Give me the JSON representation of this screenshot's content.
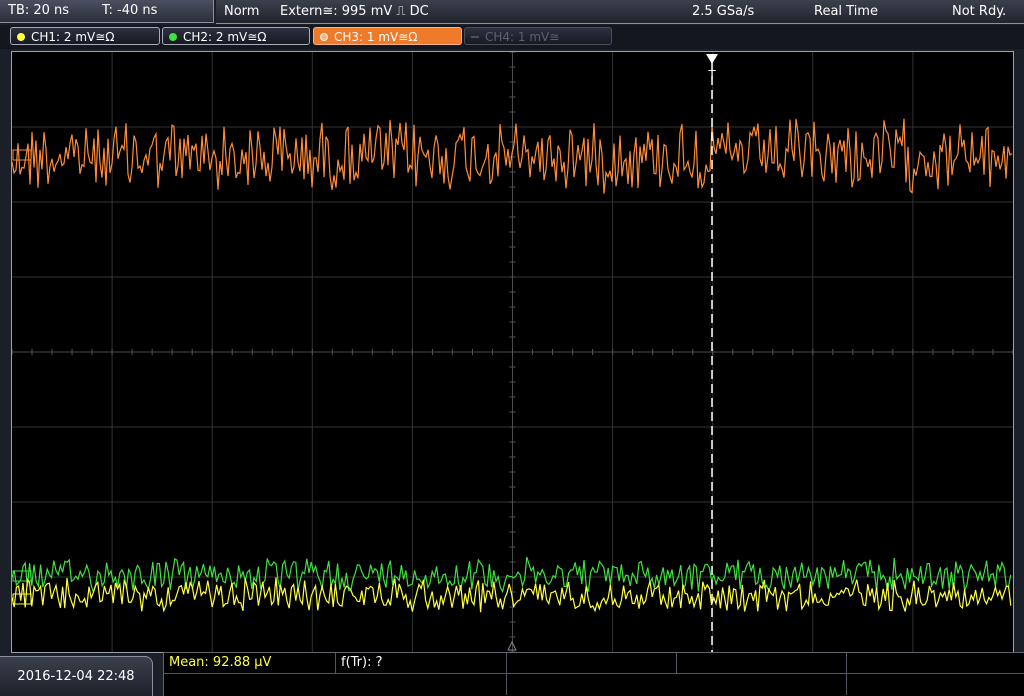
{
  "timebase": {
    "tb": "TB: 20 ns",
    "trigger_pos": "T: -40 ns"
  },
  "status": {
    "mode": "Norm",
    "trigger_source": "Extern≅: 995 mV ⎍ DC",
    "sample_rate": "2.5 GSa/s",
    "acq": "Real Time",
    "ready": "Not Rdy."
  },
  "channels": [
    {
      "label": "CH1: 2 mV≅Ω",
      "color": "#ffff40",
      "state": "on"
    },
    {
      "label": "CH2: 2 mV≅Ω",
      "color": "#40e040",
      "state": "on"
    },
    {
      "label": "CH3: 1 mV≅Ω",
      "color": "#ff8c3a",
      "state": "active"
    },
    {
      "label": "CH4: 1 mV≅",
      "color": "#5b616e",
      "state": "off"
    }
  ],
  "trigger_marker": "T",
  "datetime": "2016-12-04 22:48",
  "measurements": {
    "mean": "Mean: 92.88 µV",
    "ftr": "f(Tr): ?"
  },
  "colors": {
    "ch1": "#ffff40",
    "ch2": "#40e040",
    "ch3": "#ff8c3a",
    "grid": "#3c3c3c"
  }
}
